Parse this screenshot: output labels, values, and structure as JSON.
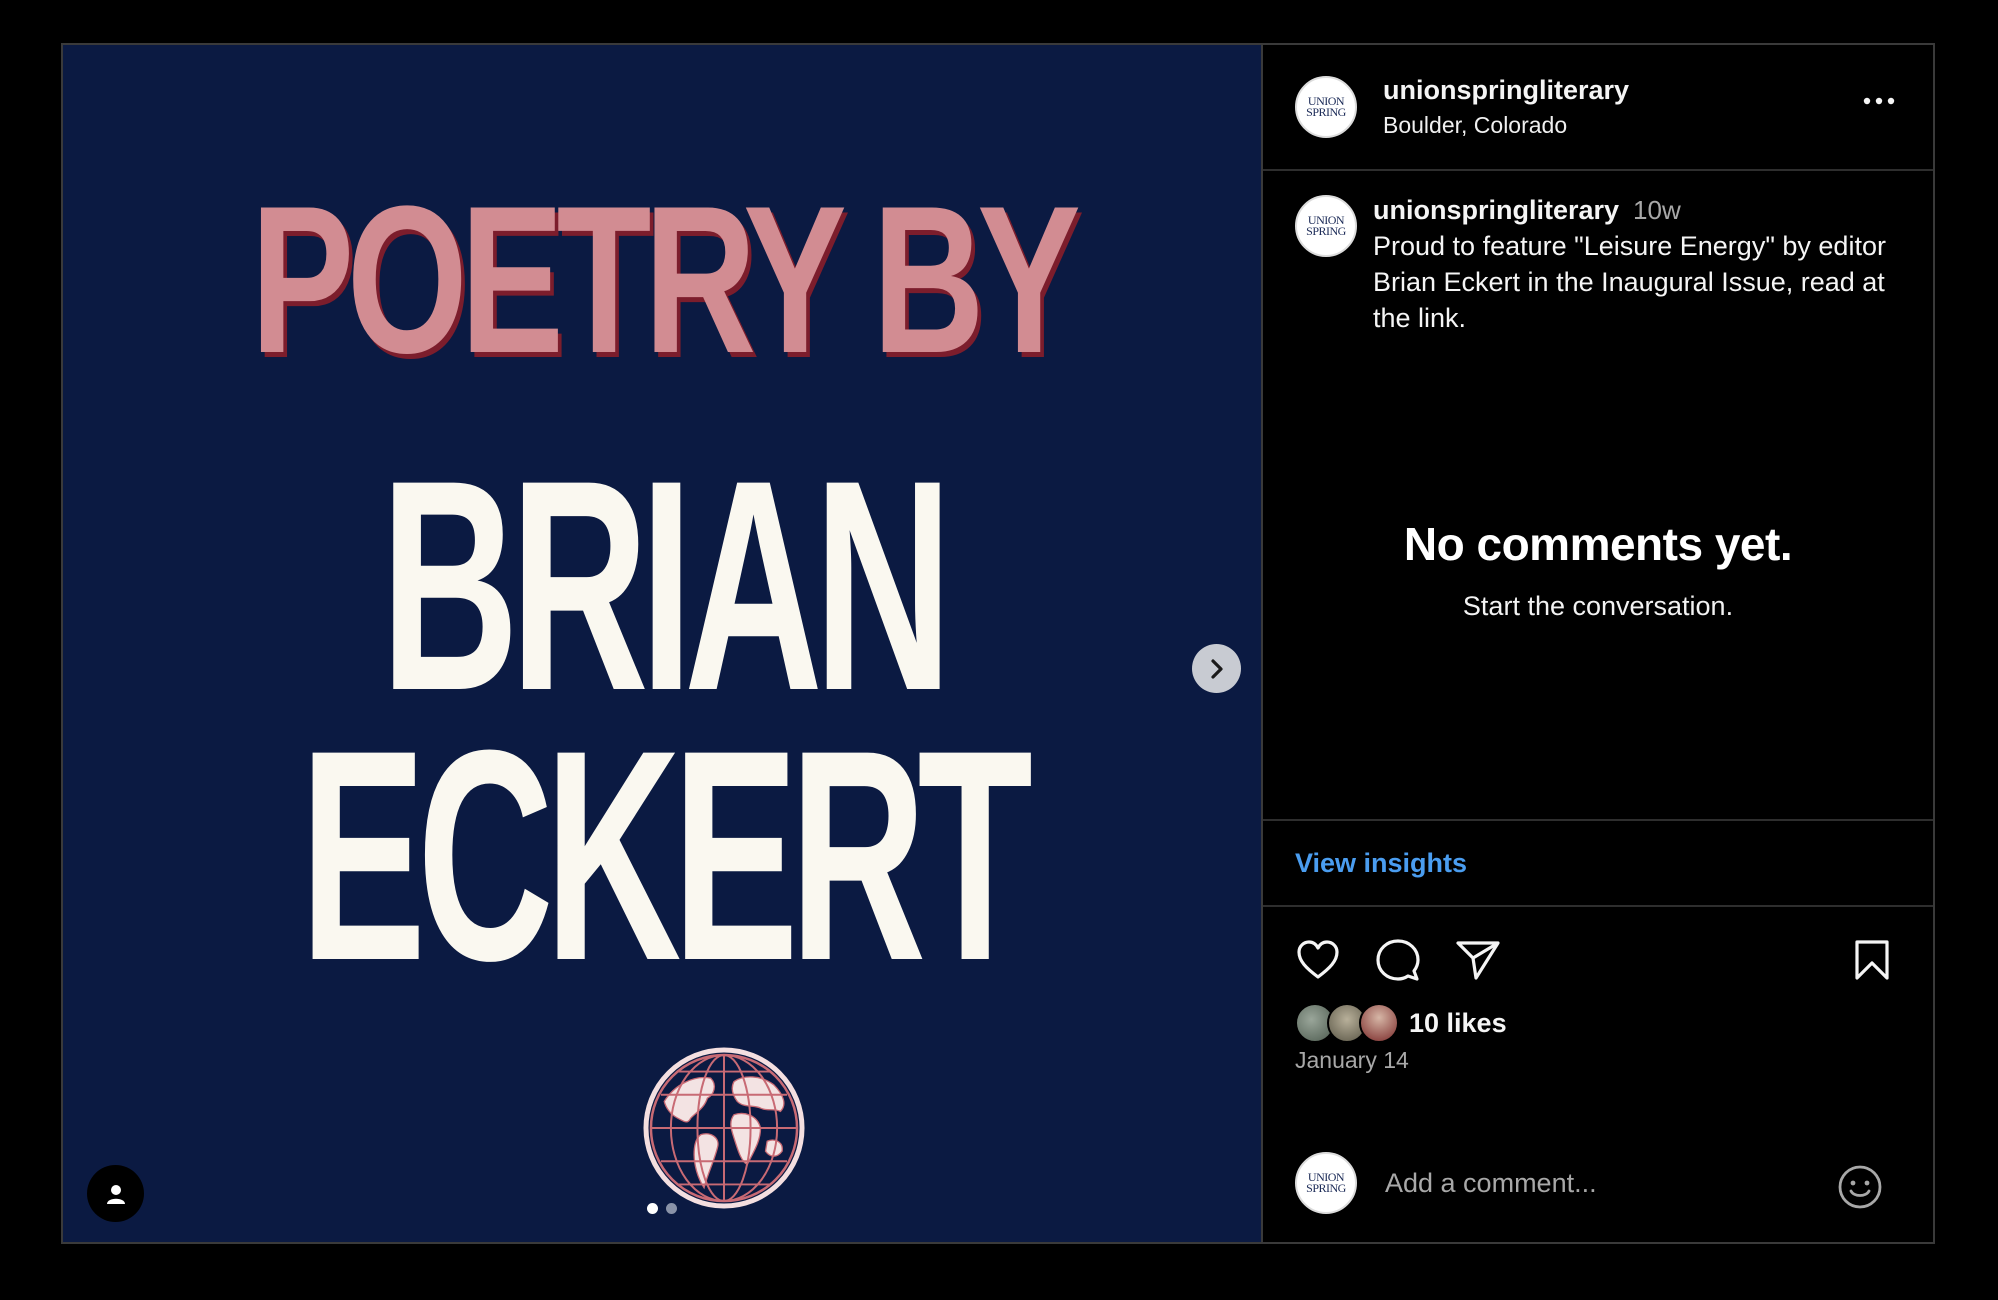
{
  "post": {
    "username": "unionspringliterary",
    "location": "Boulder, Colorado",
    "avatar_text_top": "UNION",
    "avatar_text_bottom": "SPRING"
  },
  "media": {
    "headline_line1": "POETRY BY",
    "headline_line2": "BRIAN",
    "headline_line3": "ECKERT",
    "background_color": "#0b1a42",
    "accent_color": "#d28c92",
    "slide_count": 2,
    "active_slide": 1
  },
  "caption": {
    "username": "unionspringliterary",
    "time_ago": "10w",
    "text": "Proud to feature \"Leisure Energy\" by editor Brian Eckert in the Inaugural Issue, read at the link."
  },
  "comments": {
    "empty_title": "No comments yet.",
    "empty_subtitle": "Start the conversation."
  },
  "insights": {
    "label": "View insights",
    "color": "#4a9df0"
  },
  "engagement": {
    "likes_label": "10 likes",
    "date": "January 14"
  },
  "comment_input": {
    "placeholder": "Add a comment..."
  },
  "icons": {
    "more": "more-horizontal-icon",
    "like": "heart-icon",
    "comment": "comment-bubble-icon",
    "share": "paper-plane-icon",
    "save": "bookmark-icon",
    "emoji": "smiley-icon",
    "next": "chevron-right-icon",
    "tag": "person-icon"
  }
}
